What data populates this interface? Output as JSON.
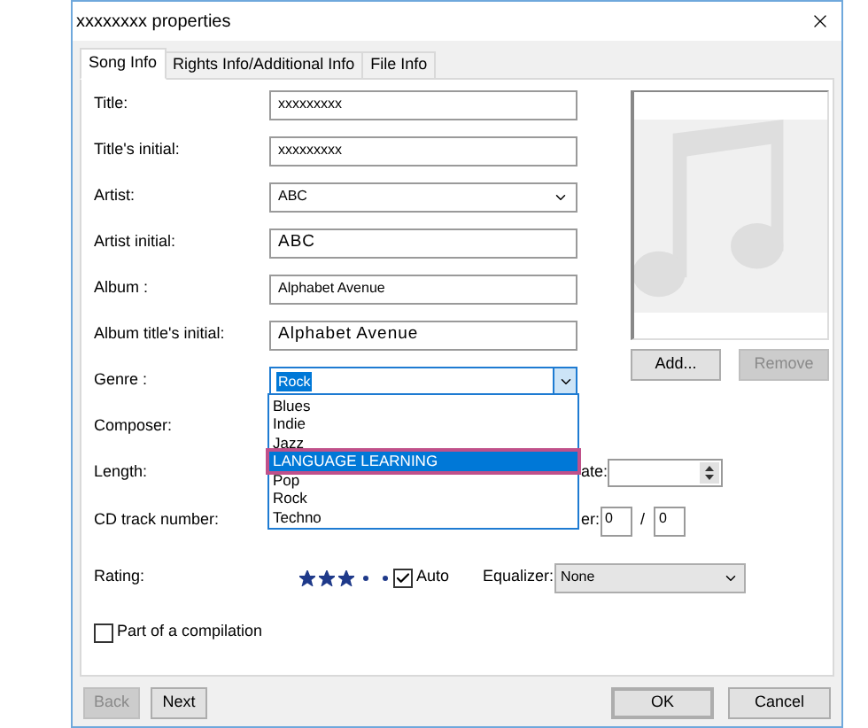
{
  "window": {
    "title": "xxxxxxxx properties"
  },
  "tabs": [
    {
      "label": "Song Info",
      "selected": true
    },
    {
      "label": "Rights Info/Additional Info",
      "selected": false
    },
    {
      "label": "File Info",
      "selected": false
    }
  ],
  "fields": [
    {
      "label": "Title:",
      "kind": "text",
      "value": "xxxxxxxxx"
    },
    {
      "label": "Title's initial:",
      "kind": "text",
      "value": "xxxxxxxxx"
    },
    {
      "label": "Artist:",
      "kind": "select",
      "value": "ABC"
    },
    {
      "label": "Artist initial:",
      "kind": "wide",
      "value": "ABC"
    },
    {
      "label": "Album :",
      "kind": "text",
      "value": "Alphabet Avenue"
    },
    {
      "label": "Album title's initial:",
      "kind": "wide",
      "value": "Alphabet  Avenue"
    },
    {
      "label": "Genre :",
      "kind": "combo",
      "value": "Rock"
    },
    {
      "label": "Composer:",
      "kind": "covered"
    }
  ],
  "length": {
    "label": "Length:",
    "side_label": "ate:"
  },
  "cd_track": {
    "label": "CD track number:",
    "side_label": "er:",
    "values": [
      "0",
      "0"
    ],
    "separator": "/"
  },
  "genre_list": [
    {
      "label": "Blues",
      "selected": false,
      "highlighted": false
    },
    {
      "label": "Indie",
      "selected": false,
      "highlighted": false
    },
    {
      "label": "Jazz",
      "selected": false,
      "highlighted": false
    },
    {
      "label": "LANGUAGE LEARNING",
      "selected": true,
      "highlighted": true
    },
    {
      "label": "Pop",
      "selected": false,
      "highlighted": false
    },
    {
      "label": "Rock",
      "selected": false,
      "highlighted": false
    },
    {
      "label": "Techno",
      "selected": false,
      "highlighted": false
    }
  ],
  "artwork_buttons": [
    {
      "label": "Add...",
      "disabled": false
    },
    {
      "label": "Remove",
      "disabled": true
    }
  ],
  "rating": {
    "label": "Rating:",
    "stars": 3
  },
  "auto": {
    "label": "Auto",
    "checked": true
  },
  "equalizer": {
    "label": "Equalizer:",
    "value": "None"
  },
  "compilation": {
    "label": "Part of a compilation",
    "checked": false
  },
  "footer_buttons": [
    {
      "label": "Back",
      "disabled": true,
      "default": false
    },
    {
      "label": "Next",
      "disabled": false,
      "default": false
    },
    {
      "label": "OK",
      "disabled": false,
      "default": true
    },
    {
      "label": "Cancel",
      "disabled": false,
      "default": false
    }
  ]
}
